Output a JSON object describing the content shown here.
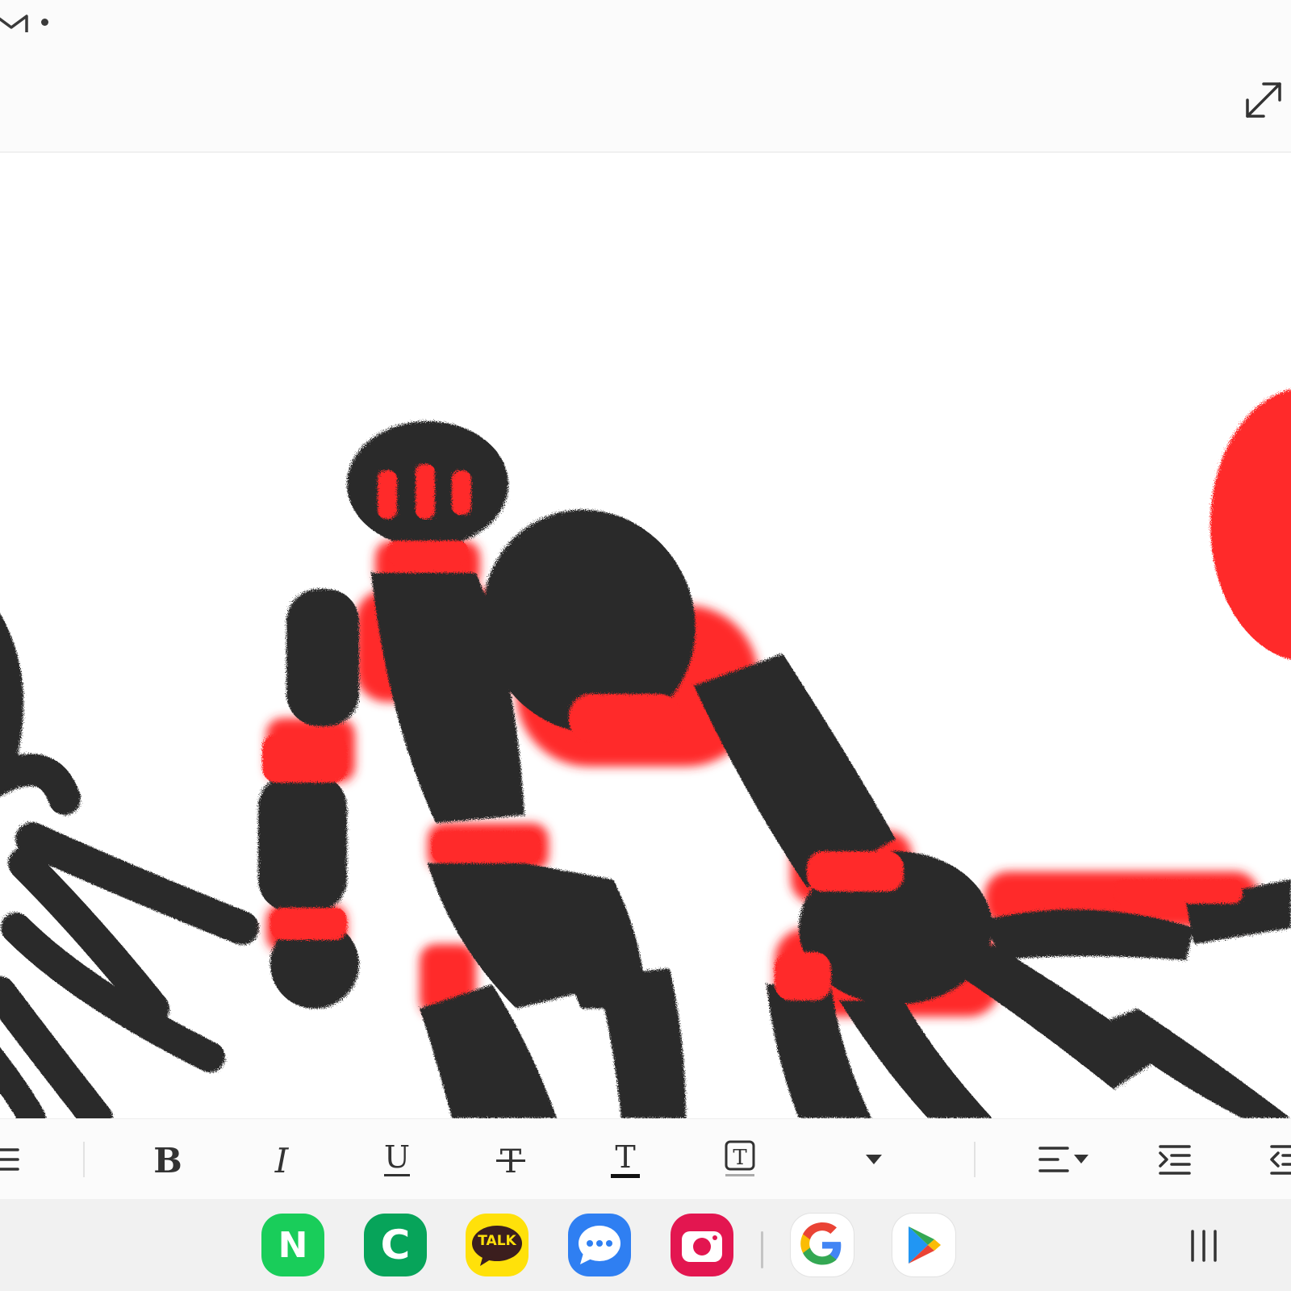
{
  "status_bar": {
    "icons": [
      "gmail-notification-icon",
      "notification-dot"
    ]
  },
  "top_bar": {
    "icons": [
      "expand-icon"
    ]
  },
  "format_toolbar": {
    "tools": [
      "list-icon",
      "bold-icon",
      "italic-icon",
      "underline-icon",
      "strikethrough-icon",
      "text-color-icon",
      "text-background-icon",
      "font-size-dropdown-icon",
      "align-icon",
      "indent-icon",
      "outdent-icon"
    ]
  },
  "dock": {
    "apps": [
      {
        "name": "naver",
        "label": "N",
        "color": "#19cd5a"
      },
      {
        "name": "c-app",
        "label": "C",
        "color": "#07a45a"
      },
      {
        "name": "kakaotalk",
        "label": "TALK",
        "color": "#ffe10a"
      },
      {
        "name": "messages",
        "color": "#2f7ff2"
      },
      {
        "name": "camera",
        "color": "#e31650"
      },
      {
        "name": "google",
        "label": "G",
        "color": "#ffffff"
      },
      {
        "name": "play-store",
        "color": "#ffffff"
      }
    ]
  },
  "colors": {
    "drawing_black": "#2a2a2a",
    "drawing_red": "#ff2a2a",
    "toolbar_bg": "#fbfbfb",
    "navbar_bg": "#f1f1f1"
  }
}
